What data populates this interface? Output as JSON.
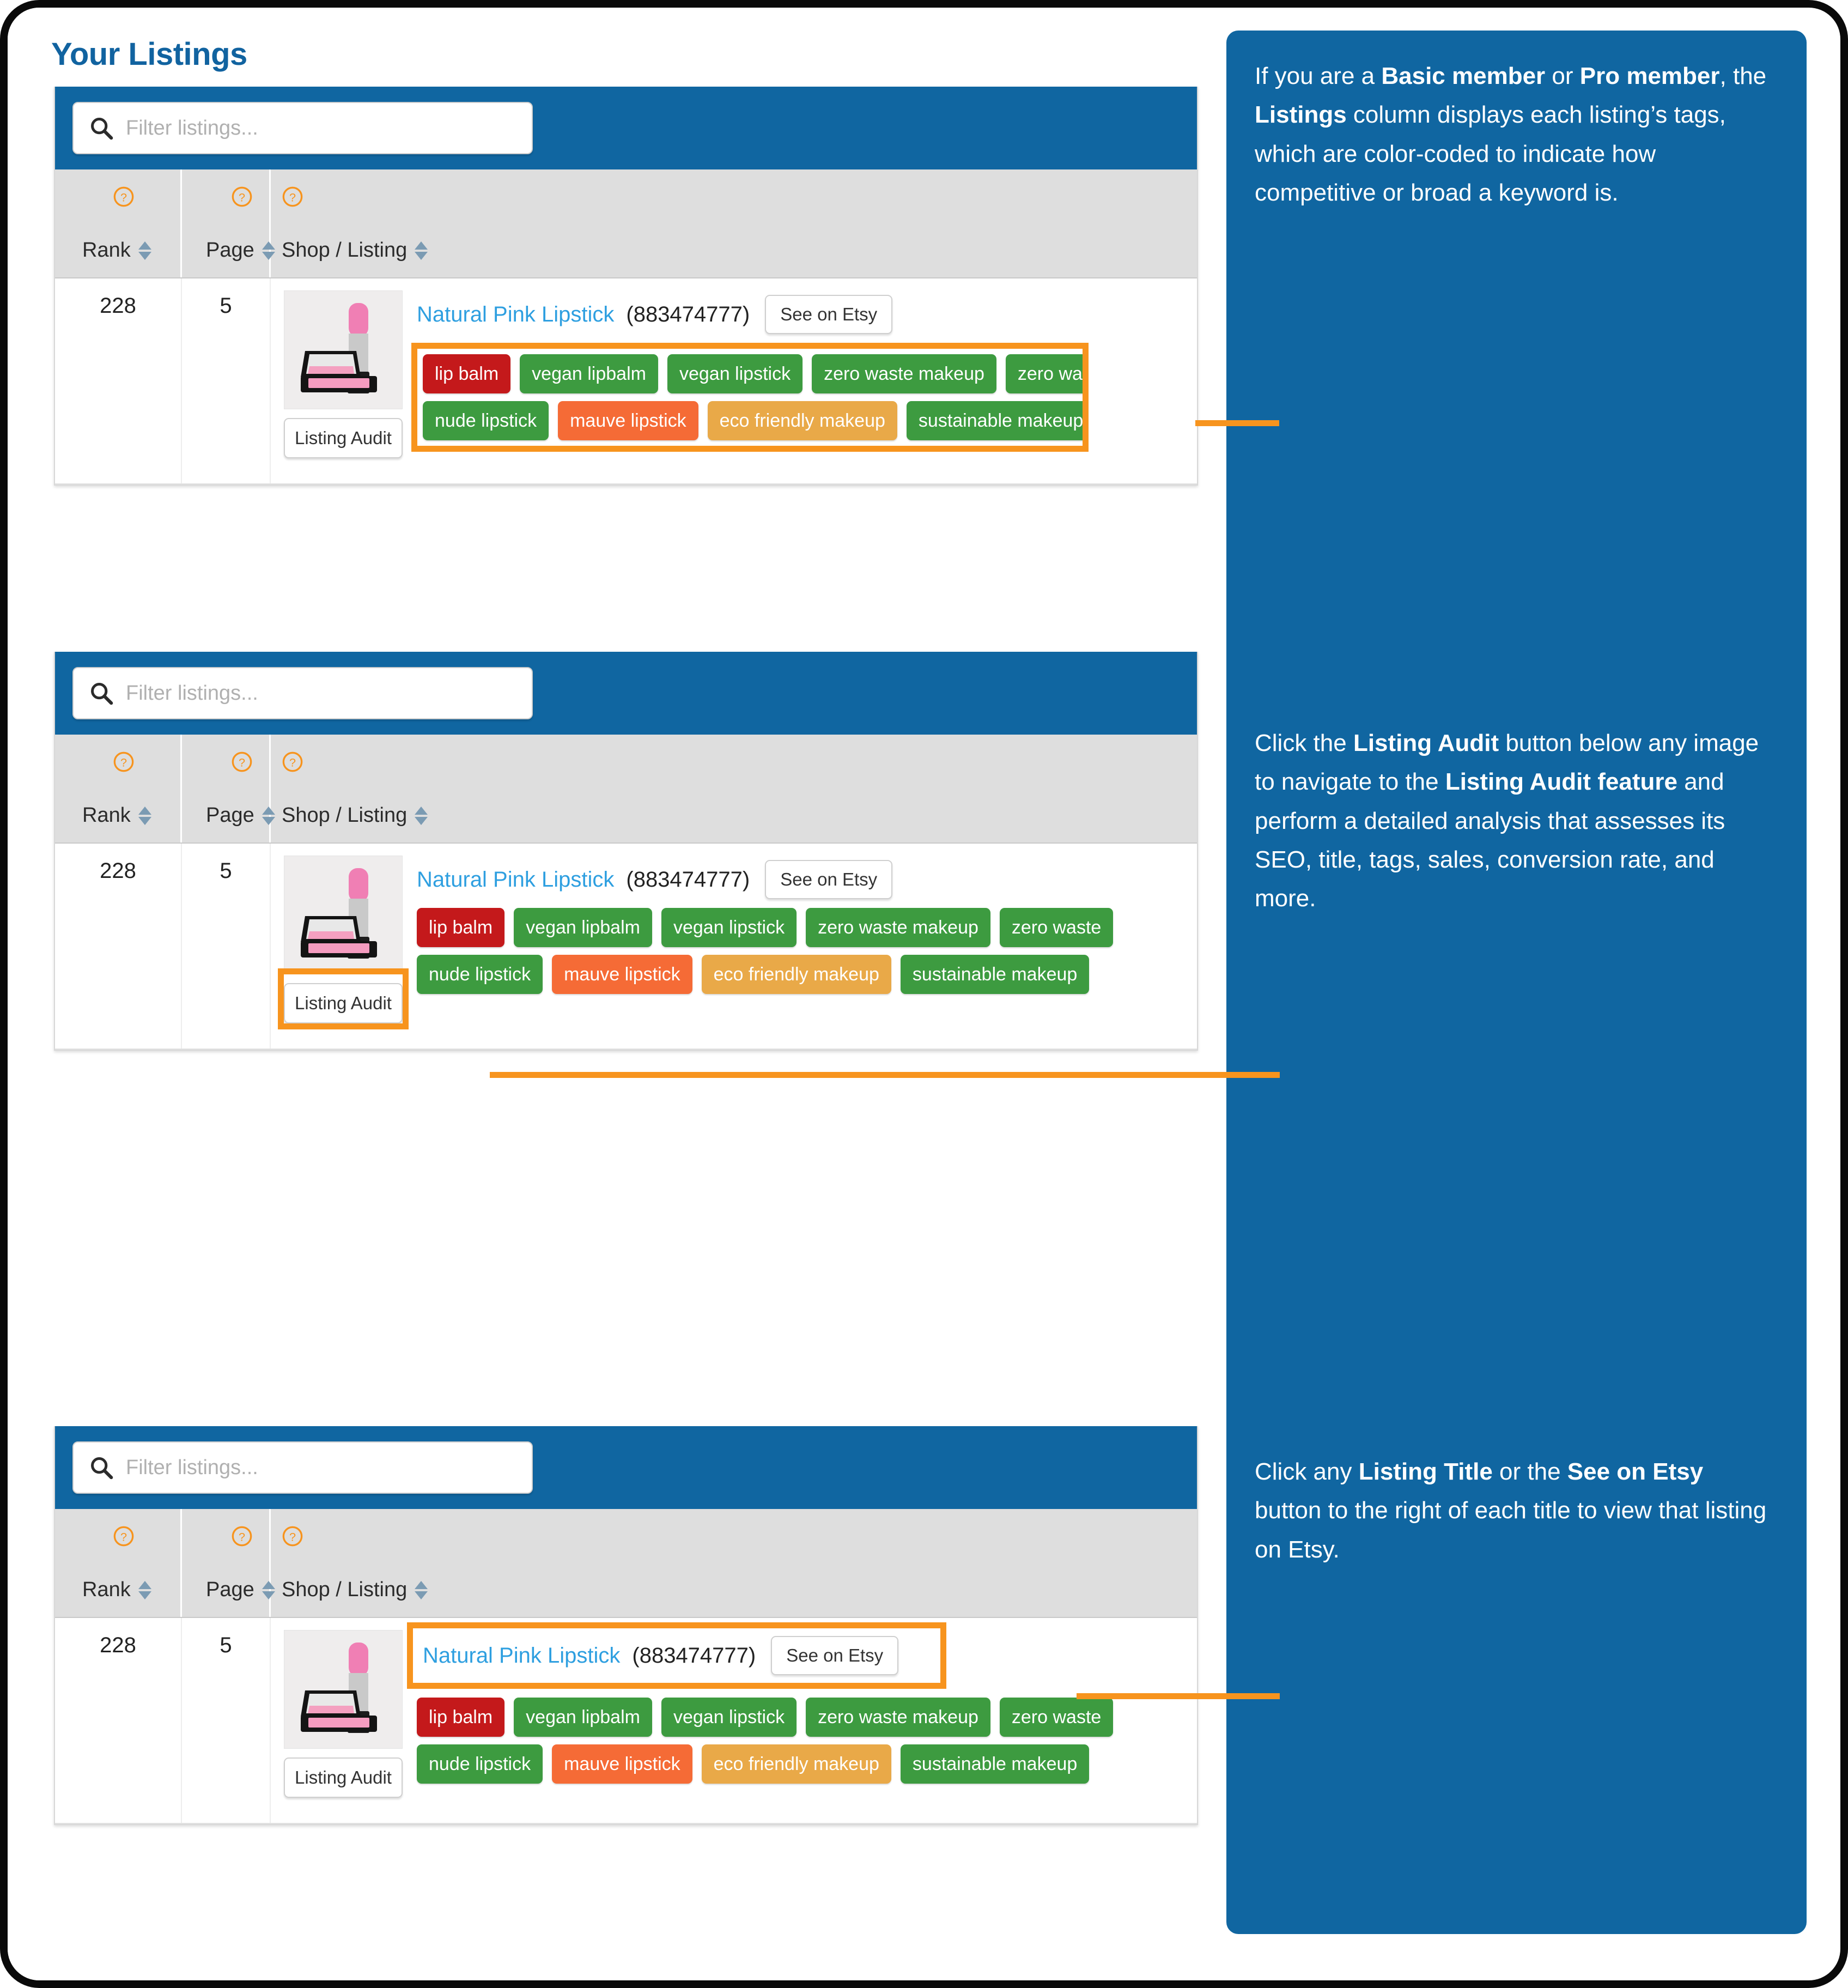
{
  "page": {
    "title": "Your Listings"
  },
  "search": {
    "placeholder": "Filter listings..."
  },
  "columns": {
    "rank": "Rank",
    "page": "Page",
    "shop": "Shop / Listing"
  },
  "listing": {
    "rank": "228",
    "page": "5",
    "title": "Natural Pink Lipstick",
    "id": "(883474777)",
    "etsy_button": "See on Etsy",
    "audit_button": "Listing Audit"
  },
  "tags": {
    "row1": [
      {
        "label": "lip balm",
        "color": "#c4191b"
      },
      {
        "label": "vegan lipbalm",
        "color": "#3d9b40"
      },
      {
        "label": "vegan lipstick",
        "color": "#3d9b40"
      },
      {
        "label": "zero waste makeup",
        "color": "#3d9b40"
      },
      {
        "label": "zero waste",
        "color": "#3d9b40"
      }
    ],
    "row2": [
      {
        "label": "nude lipstick",
        "color": "#3d9b40"
      },
      {
        "label": "mauve lipstick",
        "color": "#f56b36"
      },
      {
        "label": "eco friendly makeup",
        "color": "#e9a948"
      },
      {
        "label": "sustainable makeup",
        "color": "#3d9b40"
      }
    ]
  },
  "callouts": [
    {
      "id": "co-1",
      "html": "If you are a <b>Basic member</b> or <b>Pro member</b>, the <b>Listings</b> column displays each listing’s tags, which are color-coded to indicate how competitive or broad a keyword is."
    },
    {
      "id": "co-2",
      "html": "Click the <b>Listing Audit</b> button below any image to navigate to the <b>Listing Audit feature</b> and perform a detailed analysis that assesses its SEO, title, tags, sales, conversion rate, and more."
    },
    {
      "id": "co-3",
      "html": "Click any <b>Listing Title</b> or the <b>See on Etsy</b> button to the right of each title to view that listing on Etsy."
    }
  ],
  "colors": {
    "brand_blue": "#1066a1",
    "title_blue": "#1163a0",
    "link_blue": "#2e9fe0",
    "accent_orange": "#f7941e",
    "header_gray": "#dedede"
  },
  "icons": {
    "search": "search-icon",
    "help": "question-mark-circle-icon",
    "sort": "sort-arrows-icon"
  }
}
